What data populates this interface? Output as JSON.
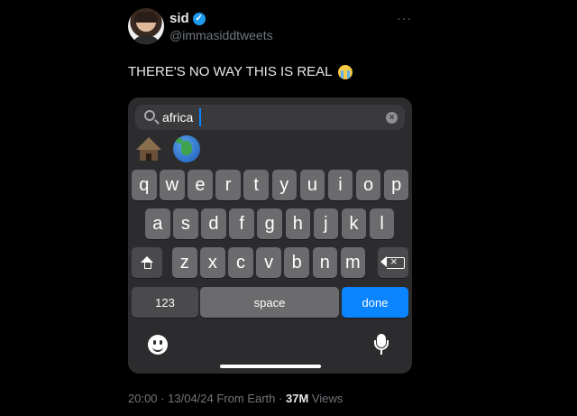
{
  "author": {
    "name": "sid",
    "handle": "@immasiddtweets",
    "verified": true,
    "more": "···"
  },
  "tweet": {
    "text": "THERE'S NO WAY THIS IS REAL",
    "emoji": "loudly-crying-face"
  },
  "keyboard": {
    "search_value": "africa",
    "clear_glyph": "×",
    "suggestions": [
      "hut-emoji",
      "globe-africa-emoji"
    ],
    "row1": [
      "q",
      "w",
      "e",
      "r",
      "t",
      "y",
      "u",
      "i",
      "o",
      "p"
    ],
    "row2": [
      "a",
      "s",
      "d",
      "f",
      "g",
      "h",
      "j",
      "k",
      "l"
    ],
    "row3": [
      "z",
      "x",
      "c",
      "v",
      "b",
      "n",
      "m"
    ],
    "numbers_label": "123",
    "space_label": "space",
    "done_label": "done",
    "colors": {
      "key": "#6b6b6e",
      "special_key": "#4a4a4d",
      "accent": "#0a84ff",
      "panel": "#2c2c2e"
    }
  },
  "meta": {
    "time": "20:00",
    "sep1": "·",
    "date": "13/04/24",
    "source": "From Earth",
    "sep2": "·",
    "views_count": "37M",
    "views_label": "Views"
  }
}
